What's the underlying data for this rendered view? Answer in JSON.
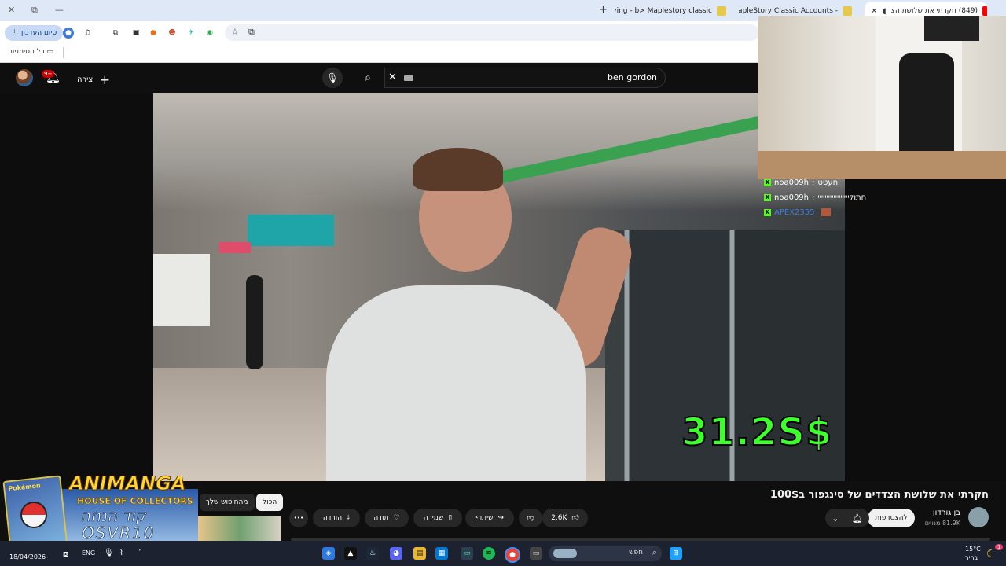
{
  "browser": {
    "window_controls": [
      "✕",
      "⧉",
      "—"
    ],
    "new_tab_symbol": "+",
    "tabs": [
      {
        "title": "Buying - b> Maplestory classic",
        "active": false
      },
      {
        "title": "MapleStory Classic Accounts -",
        "active": false
      },
      {
        "title": "(849) חקרתי את שלושת הצ",
        "active": true
      }
    ],
    "end_session_label": "סיום העדכון",
    "bookmarks_label": "כל הסימניות"
  },
  "youtube": {
    "notification_count": "9+",
    "create_label": "יצירה",
    "search_query": "ben gordon"
  },
  "video": {
    "overlay_price": "31.2S$",
    "title": "חקרתי את שלושת הצדדים של סינגפור ב100$",
    "channel_name": "בן גורדון",
    "subscribers": "81.9K מנויים",
    "join_label": "להצטרפות",
    "likes": "2.6K",
    "share_label": "שיתוף",
    "save_label": "שמירה",
    "thanks_label": "תודה",
    "download_label": "הורדה",
    "more_symbol": "•••",
    "chip_all": "הכול",
    "chip_search": "מהחיפוש שלך"
  },
  "chat": [
    {
      "user": "noa009h",
      "message": "חעטט"
    },
    {
      "user": "noa009h",
      "message": "חתוליייייייייייייייייי"
    },
    {
      "user": "APEX2355",
      "message": ""
    }
  ],
  "ad": {
    "brand": "ANIMANGA",
    "tagline": "HOUSE OF COLLECTORS",
    "code_label": "קוד הנחה",
    "code": "OSVR10",
    "card_text": "Pokémon"
  },
  "taskbar": {
    "date": "18/04/2026",
    "language": "ENG",
    "search_label": "חפש",
    "temperature": "15°C",
    "weather": "בהיר",
    "notification_badge": "1"
  },
  "colors": {
    "price_green": "#3cff2c",
    "kick_green": "#53fc18",
    "youtube_red": "#cc0000"
  }
}
